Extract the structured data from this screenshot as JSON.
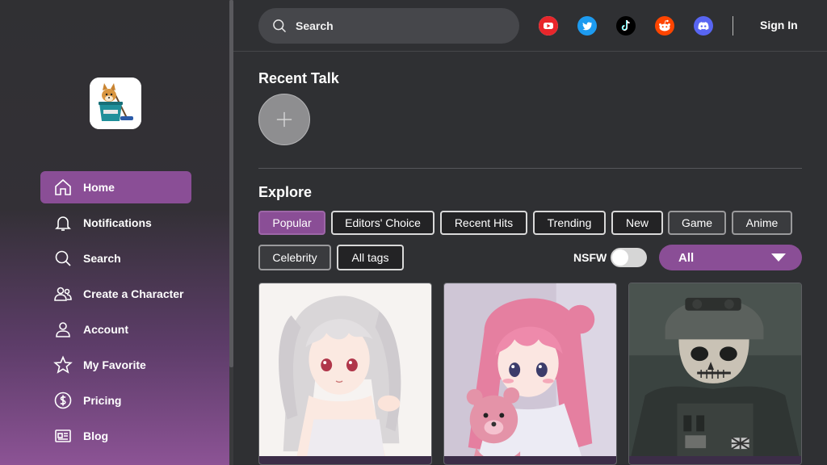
{
  "nav": {
    "items": [
      {
        "label": "Home",
        "icon": "home-icon",
        "active": true
      },
      {
        "label": "Notifications",
        "icon": "bell-icon",
        "active": false
      },
      {
        "label": "Search",
        "icon": "search-icon",
        "active": false
      },
      {
        "label": "Create a Character",
        "icon": "users-icon",
        "active": false
      },
      {
        "label": "Account",
        "icon": "user-icon",
        "active": false
      },
      {
        "label": "My Favorite",
        "icon": "star-icon",
        "active": false
      },
      {
        "label": "Pricing",
        "icon": "dollar-icon",
        "active": false
      },
      {
        "label": "Blog",
        "icon": "newspaper-icon",
        "active": false
      }
    ]
  },
  "header": {
    "search_placeholder": "Search",
    "social": [
      "youtube-icon",
      "twitter-icon",
      "tiktok-icon",
      "reddit-icon",
      "discord-icon"
    ],
    "sign_in": "Sign In"
  },
  "recent_talk": {
    "title": "Recent Talk"
  },
  "explore": {
    "title": "Explore",
    "tags": [
      "Popular",
      "Editors' Choice",
      "Recent Hits",
      "Trending",
      "New",
      "Game",
      "Anime",
      "Celebrity",
      "All tags"
    ],
    "active_tag": "Popular",
    "nsfw_label": "NSFW",
    "nsfw_enabled": false,
    "filter_value": "All"
  },
  "cards": [
    {
      "name": "white-haired-anime-girl"
    },
    {
      "name": "pink-haired-girl-with-bear"
    },
    {
      "name": "skull-mask-soldier"
    }
  ],
  "colors": {
    "accent": "#8a4e96",
    "background": "#2f3033",
    "search_bg": "#46474b"
  }
}
